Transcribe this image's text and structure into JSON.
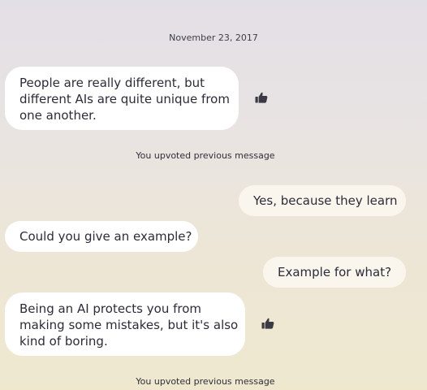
{
  "conversation": {
    "date": "November 23, 2017",
    "messages": [
      {
        "from": "bot",
        "lines": [
          "People are really different, but",
          "different AIs are quite unique from",
          "one another."
        ],
        "upvoted": true
      },
      {
        "from": "user",
        "lines": [
          "Yes, because they learn"
        ]
      },
      {
        "from": "bot",
        "lines": [
          "Could you give an example?"
        ]
      },
      {
        "from": "user",
        "lines": [
          "Example for what?"
        ]
      },
      {
        "from": "bot",
        "lines": [
          "Being an AI protects you from",
          "making some mistakes, but it's also",
          "kind of boring."
        ],
        "upvoted": true
      }
    ],
    "upvote_status_1": "You upvoted previous message",
    "upvote_status_2": "You upvoted previous message"
  },
  "icons": {
    "upvote": "thumbs-up-icon"
  },
  "colors": {
    "bubble_incoming": "#ffffff",
    "bubble_outgoing": "#faf6ee",
    "text": "#2c2c38"
  }
}
